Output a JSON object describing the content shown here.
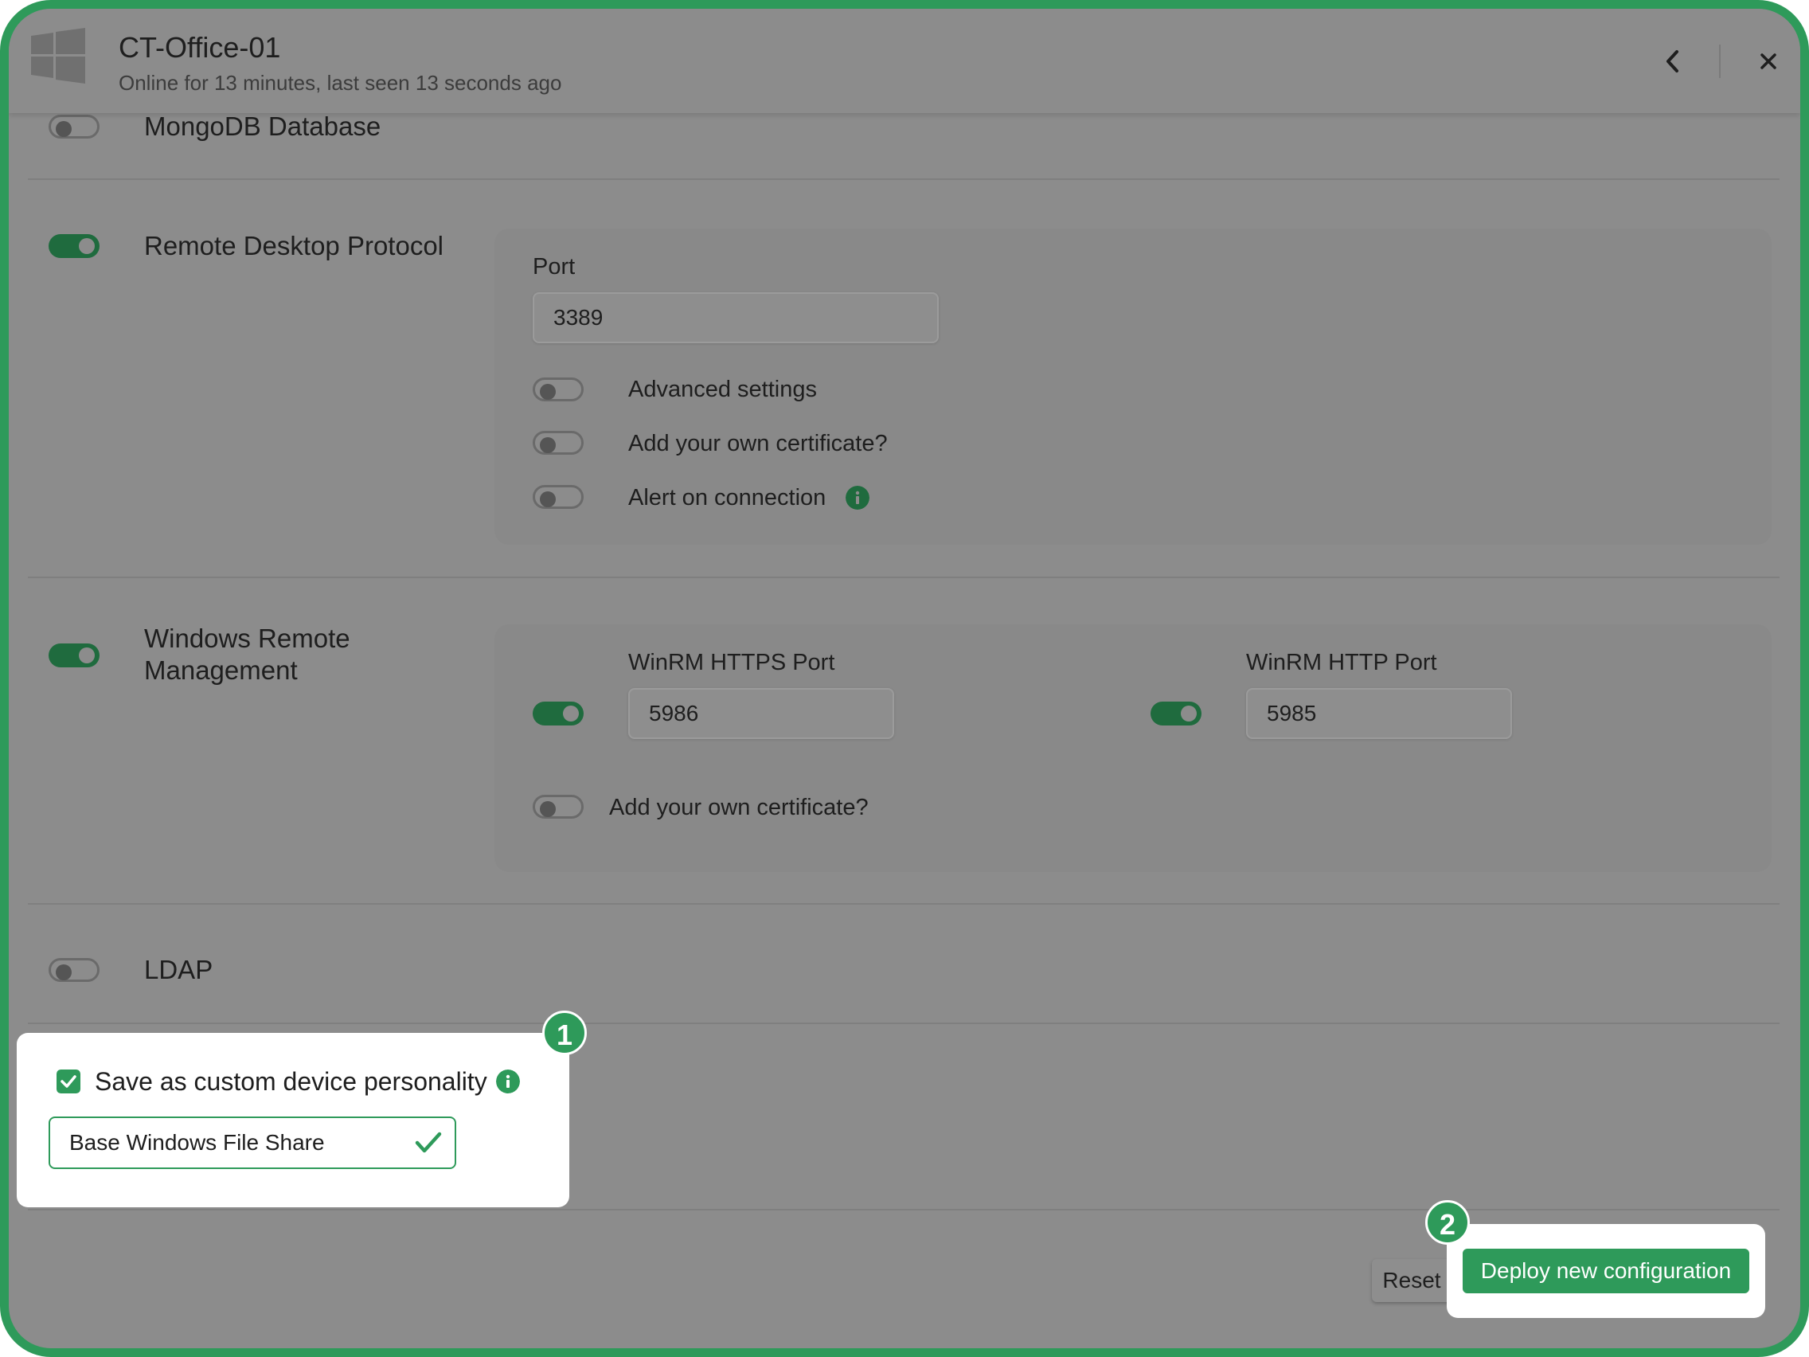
{
  "header": {
    "device_name": "CT-Office-01",
    "status": "Online for 13 minutes, last seen 13 seconds ago",
    "os_icon": "windows-logo-icon",
    "back_icon": "chevron-left-icon",
    "close_icon": "close-icon"
  },
  "services": {
    "mongodb": {
      "label": "MongoDB Database",
      "enabled": false
    },
    "rdp": {
      "label": "Remote Desktop Protocol",
      "enabled": true,
      "port_label": "Port",
      "port_value": "3389",
      "options": [
        {
          "label": "Advanced settings",
          "enabled": false
        },
        {
          "label": "Add your own certificate?",
          "enabled": false
        },
        {
          "label": "Alert on connection",
          "enabled": false,
          "info_icon": "info-icon"
        }
      ]
    },
    "winrm": {
      "label_line1": "Windows Remote",
      "label_line2": "Management",
      "enabled": true,
      "https_port_label": "WinRM HTTPS Port",
      "https_port_value": "5986",
      "https_enabled": true,
      "http_port_label": "WinRM HTTP Port",
      "http_port_value": "5985",
      "http_enabled": true,
      "cert_label": "Add your own certificate?",
      "cert_enabled": false
    },
    "ldap": {
      "label": "LDAP",
      "enabled": false
    }
  },
  "personality": {
    "checkbox_label": "Save as custom device personality",
    "checked": true,
    "name_value": "Base Windows File Share",
    "callout_number": "1"
  },
  "footer": {
    "reset_label": "Reset",
    "deploy_label": "Deploy new configuration",
    "callout_number": "2"
  },
  "colors": {
    "accent": "#2e9a5a",
    "toggle_on": "#1f6b3e",
    "overlay": "#8c8c8c"
  }
}
